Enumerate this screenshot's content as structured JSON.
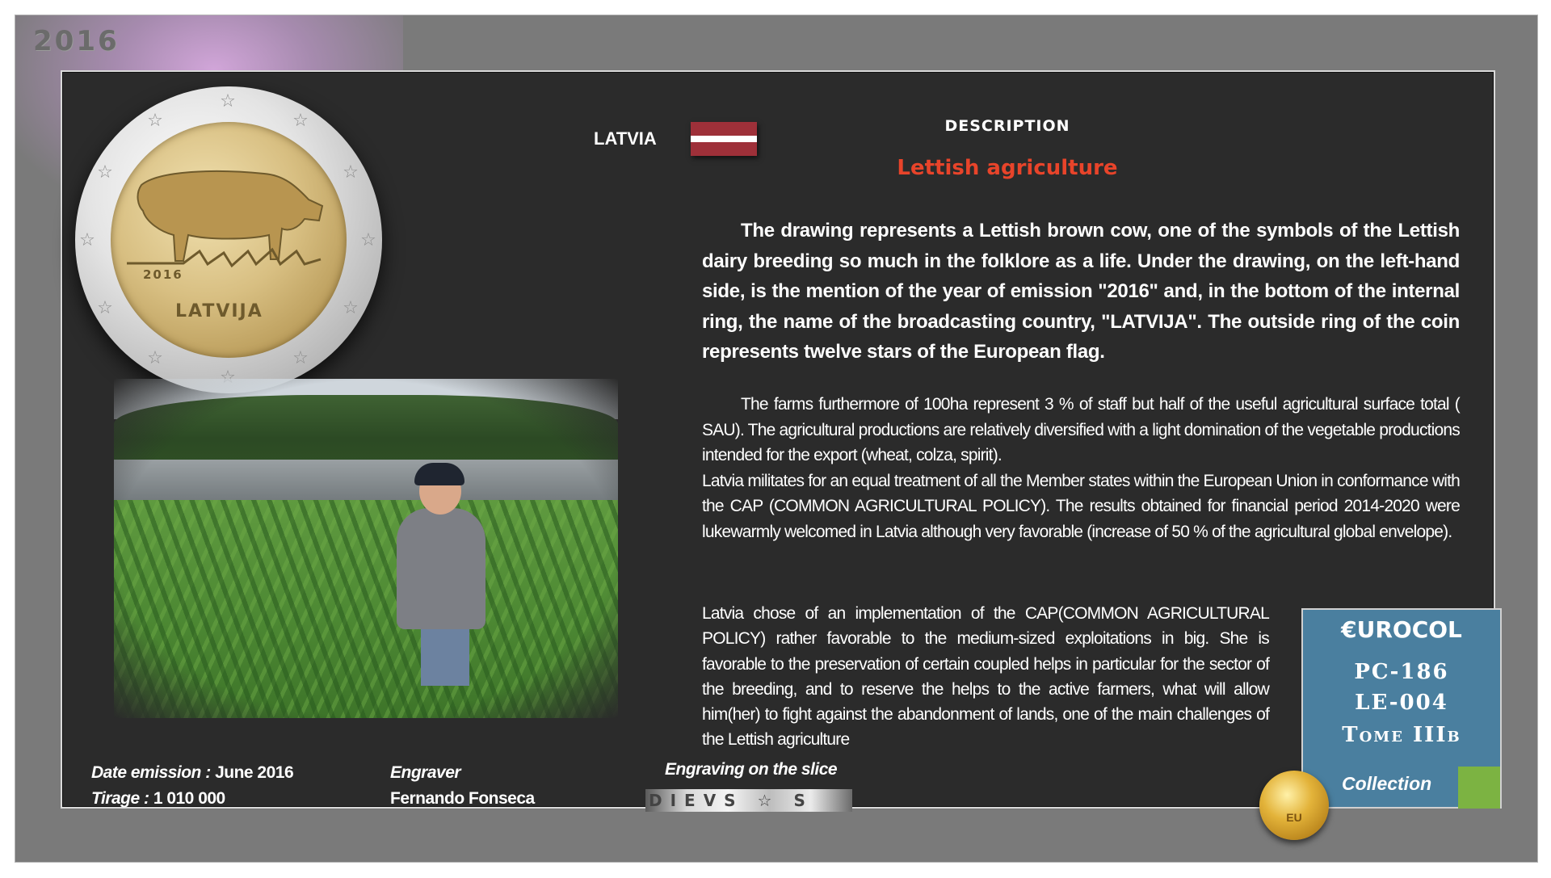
{
  "corner_year": "2016",
  "coin": {
    "year": "2016",
    "country_name": "LATVIJA"
  },
  "header": {
    "country": "LATVIA",
    "description_heading": "DESCRIPTION",
    "subtitle": "Lettish agriculture"
  },
  "description": {
    "paragraph1": "The drawing represents a Lettish brown cow, one of the symbols of the Lettish dairy breeding so much in the folklore as a life. Under the drawing, on the left-hand side, is the mention of the year of emission \"2016\" and, in the bottom of the internal ring, the name of the broadcasting country, \"LATVIJA\". The outside ring of the coin represents twelve stars of the European flag.",
    "paragraph2": "The farms furthermore of 100ha represent 3 % of staff but half of the useful agricultural surface total ( SAU). The agricultural productions are relatively diversified with a light domination of the vegetable productions intended for the export (wheat, colza, spirit).",
    "paragraph3": "Latvia militates for an equal treatment of all the Member states within the European Union in conformance with the CAP (COMMON AGRICULTURAL POLICY). The results obtained for financial period 2014-2020 were lukewarmly welcomed in Latvia although very favorable (increase of 50 % of the agricultural global envelope).",
    "paragraph4": "Latvia chose of an implementation of the CAP(COMMON AGRICULTURAL POLICY) rather favorable to the medium-sized exploitations in big. She is favorable to the preservation of certain coupled helps in particular for the sector of the breeding, and to reserve the helps to the active farmers, what will allow him(her) to fight against the abandonment of lands, one of the main challenges of the Lettish agriculture"
  },
  "eurocol": {
    "title": "€UROCOL",
    "code1": "PC-186",
    "code2": "LE-004",
    "tome": "Tome IIIb",
    "collection": "Collection"
  },
  "footer": {
    "date_label": "Date emission : ",
    "date_value": "June  2016",
    "tirage_label": "Tirage : ",
    "tirage_value": "1 010 000",
    "engraver_label": "Engraver",
    "engraver_name": "Fernando Fonseca",
    "slice_label": "Engraving on the slice",
    "slice_text": "DIEVS ☆ S"
  },
  "colors": {
    "subtitle": "#e8442a",
    "panel": "#2b2b2b",
    "eurocol_box": "#4a7f9f",
    "collection_swatch": "#7cb342",
    "flag_red": "#9e3039"
  }
}
